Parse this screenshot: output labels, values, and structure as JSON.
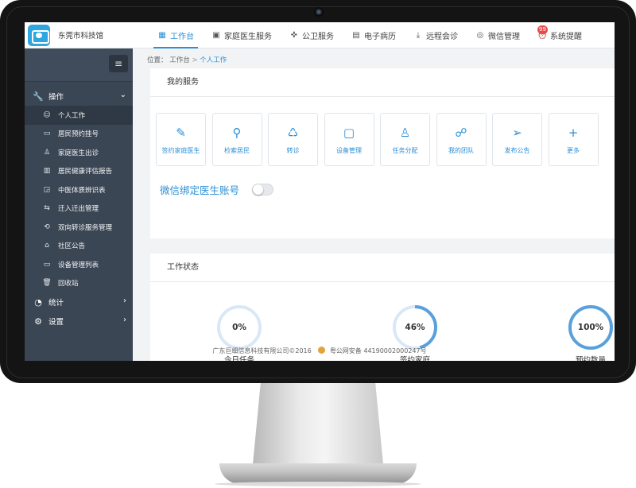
{
  "app": {
    "brand_name": "东莞市科技馆"
  },
  "topnav": [
    {
      "label": "工作台",
      "icon": "grid-icon",
      "glyph": "▦",
      "active": true
    },
    {
      "label": "家庭医生服务",
      "icon": "doctor-bag-icon",
      "glyph": "▣",
      "active": false
    },
    {
      "label": "公卫服务",
      "icon": "cross-circle-icon",
      "glyph": "✜",
      "active": false
    },
    {
      "label": "电子病历",
      "icon": "document-icon",
      "glyph": "▤",
      "active": false
    },
    {
      "label": "远程会诊",
      "icon": "download-icon",
      "glyph": "⤓",
      "active": false
    },
    {
      "label": "微信管理",
      "icon": "wechat-icon",
      "glyph": "◎",
      "active": false
    },
    {
      "label": "系统提醒",
      "icon": "alarm-clock-icon",
      "glyph": "⏰",
      "active": false,
      "badge": "99"
    }
  ],
  "sidebar": {
    "toggle_glyph": "≡",
    "group_ops": {
      "label": "操作",
      "icon": "wrench-icon",
      "glyph": "🔧",
      "arrow": "⌄"
    },
    "items": [
      {
        "label": "个人工作",
        "icon": "person-circle-icon",
        "glyph": "☺",
        "active": true
      },
      {
        "label": "居民预约挂号",
        "icon": "clipboard-icon",
        "glyph": "▭"
      },
      {
        "label": "家庭医生出诊",
        "icon": "doctor-icon",
        "glyph": "♙"
      },
      {
        "label": "居民健康评估报告",
        "icon": "report-icon",
        "glyph": "▥"
      },
      {
        "label": "中医体质辨识表",
        "icon": "table-icon",
        "glyph": "◲"
      },
      {
        "label": "迁入迁出管理",
        "icon": "transfer-icon",
        "glyph": "⇆"
      },
      {
        "label": "双向转诊服务管理",
        "icon": "refresh-icon",
        "glyph": "⟲"
      },
      {
        "label": "社区公告",
        "icon": "house-icon",
        "glyph": "⌂"
      },
      {
        "label": "设备管理列表",
        "icon": "monitor-icon",
        "glyph": "▭"
      },
      {
        "label": "回收站",
        "icon": "trash-icon",
        "glyph": "🗑"
      }
    ],
    "group_stats": {
      "label": "统计",
      "icon": "pie-chart-icon",
      "glyph": "◔",
      "arrow": "›"
    },
    "group_settings": {
      "label": "设置",
      "icon": "gear-icon",
      "glyph": "⚙",
      "arrow": "›"
    }
  },
  "breadcrumb": {
    "prefix": "位置：",
    "home": "工作台",
    "sep": ">",
    "current": "个人工作"
  },
  "services": {
    "title": "我的服务",
    "tiles": [
      {
        "label": "签约家庭医生",
        "icon": "edit-icon",
        "glyph": "✎"
      },
      {
        "label": "检索居民",
        "icon": "search-icon",
        "glyph": "⚲"
      },
      {
        "label": "转诊",
        "icon": "refer-icon",
        "glyph": "♺"
      },
      {
        "label": "设备管理",
        "icon": "monitor-check-icon",
        "glyph": "▢"
      },
      {
        "label": "任务分配",
        "icon": "person-task-icon",
        "glyph": "♙"
      },
      {
        "label": "我的团队",
        "icon": "team-icon",
        "glyph": "☍"
      },
      {
        "label": "发布公告",
        "icon": "paper-plane-icon",
        "glyph": "➢"
      },
      {
        "label": "更多",
        "icon": "plus-icon",
        "glyph": "+"
      }
    ],
    "wechat_bind_label": "微信绑定医生账号",
    "wechat_bind_on": false
  },
  "status": {
    "title": "工作状态",
    "gauges": [
      {
        "label": "今日任务",
        "value_text": "0%",
        "percent": 0
      },
      {
        "label": "签约家庭",
        "value_text": "46%",
        "percent": 46
      },
      {
        "label": "预约数量",
        "value_text": "100%",
        "percent": 100
      }
    ],
    "colors": {
      "track": "#d9e8f6",
      "fill": "#5aa0dc"
    }
  },
  "footer": {
    "copyright": "广东巨细信息科技有限公司©2016",
    "icp": "粤公网安备 44190002000247号"
  }
}
